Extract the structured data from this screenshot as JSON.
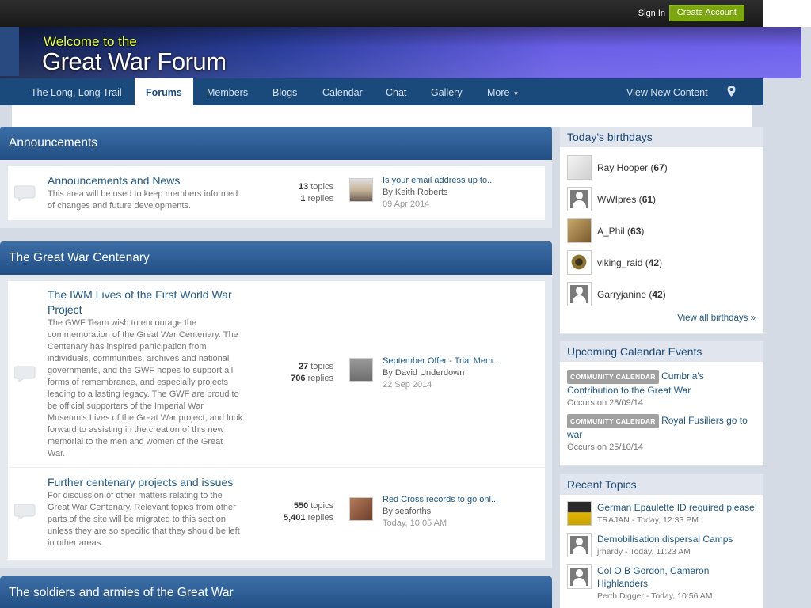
{
  "topbar": {
    "sign_in": "Sign In",
    "create_account": "Create Account"
  },
  "banner": {
    "welcome": "Welcome to the",
    "title": "Great War Forum"
  },
  "nav": {
    "items": [
      "The Long, Long Trail",
      "Forums",
      "Members",
      "Blogs",
      "Calendar",
      "Chat",
      "Gallery",
      "More"
    ],
    "active": "Forums",
    "view_new": "View New Content",
    "pin_icon": "map-pin-icon"
  },
  "categories": [
    {
      "title": "Announcements",
      "forums": [
        {
          "title": "Announcements and News",
          "desc": [
            "This area will be used to keep members informed",
            "of changes and future developments."
          ],
          "topics": "13",
          "replies": "1",
          "last_title": "Is your email address up to...",
          "last_by": "By Keith Roberts",
          "last_date": "09 Apr 2014"
        }
      ]
    },
    {
      "title": "The Great War Centenary",
      "forums": [
        {
          "title": [
            "The IWM Lives of the First World War",
            "Project"
          ],
          "desc": [
            "The GWF Team wish to encourage the",
            "commemoration of the Great War Centenary. The",
            "Centenary has inspired participation from",
            "individuals, communities, archives and national",
            "governments, and the GWF hopes to support all",
            "forms of remembrance, and especially projects",
            "leading to a lasting legacy. The GWF are proud to",
            "be official supporters of the Imperial War",
            "Museum's Lives of the Great War project, and look",
            "forward to assisting in the creation of this new",
            "memorial to the men and women of the Great",
            "War."
          ],
          "topics": "27",
          "replies": "706",
          "last_title": "September Offer - Trial Mem...",
          "last_by": "By David Underdown",
          "last_date": "22 Sep 2014"
        },
        {
          "title": "Further centenary projects and issues",
          "desc": [
            "For discussion of other matters relating to the",
            "Great War Centenary. Relevant topics from other",
            "parts of the site will be migrated to this section,",
            "unless they are so specific that they should be left",
            "in other areas."
          ],
          "topics": "550",
          "replies": "5,401",
          "last_title": "Red Cross records to go onl...",
          "last_by": "By seaforths",
          "last_date": "Today, 10:05 AM"
        }
      ]
    },
    {
      "title": "The soldiers and armies of the Great War"
    }
  ],
  "labels": {
    "topics": "topics",
    "replies": "replies"
  },
  "sidebar": {
    "birthdays": {
      "title": "Today's birthdays",
      "people": [
        {
          "name": "Ray Hooper",
          "age": "67"
        },
        {
          "name": "WWIpres",
          "age": "61"
        },
        {
          "name": "A_Phil",
          "age": "63"
        },
        {
          "name": "viking_raid",
          "age": "42"
        },
        {
          "name": "Garryjanine",
          "age": "42"
        }
      ],
      "view_all": "View all birthdays »"
    },
    "events": {
      "title": "Upcoming Calendar Events",
      "badge": "COMMUNITY CALENDAR",
      "items": [
        {
          "title_a": "Cumbria's",
          "title_b": "Contribution to the Great War",
          "occurs": "Occurs on 28/09/14"
        },
        {
          "title_a": "Royal Fusiliers go to",
          "title_b": "war",
          "occurs": "Occurs on 25/10/14"
        }
      ]
    },
    "recent": {
      "title": "Recent Topics",
      "items": [
        {
          "title": "German Epaulette ID required please!",
          "meta": "TRAJAN - Today, 12:33 PM"
        },
        {
          "title": "Demobilisation dispersal Camps",
          "meta": "jrhardy - Today, 11:23 AM"
        },
        {
          "title": "Col O B Gordon, Cameron Highlanders",
          "meta": "Perth Digger - Today, 10:56 AM"
        }
      ]
    }
  },
  "colors": {
    "accent": "#1a4a7c",
    "category_header": "#2d5e97",
    "create_button": "#7ba60d",
    "link": "#225985"
  }
}
